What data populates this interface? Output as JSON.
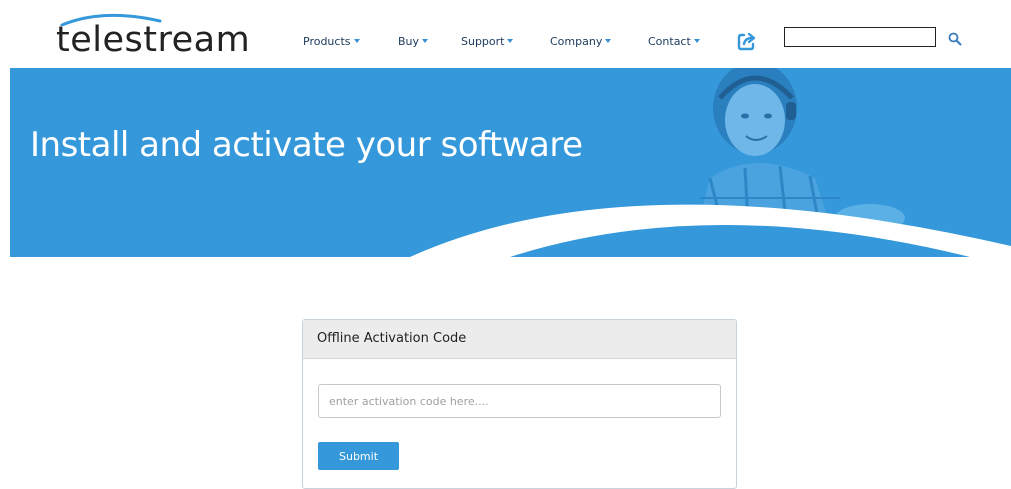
{
  "header": {
    "logo_text": "telestream",
    "nav": [
      {
        "label": "Products",
        "name": "nav-products"
      },
      {
        "label": "Buy",
        "name": "nav-buy"
      },
      {
        "label": "Support",
        "name": "nav-support"
      },
      {
        "label": "Company",
        "name": "nav-company"
      },
      {
        "label": "Contact",
        "name": "nav-contact"
      }
    ],
    "search": {
      "value": "",
      "placeholder": ""
    },
    "icons": {
      "share": "share-arrow-icon",
      "search": "search-icon"
    }
  },
  "hero": {
    "title": "Install and activate your software",
    "background_color": "#3498db"
  },
  "activation_panel": {
    "heading": "Offline Activation Code",
    "input_placeholder": "enter activation code here....",
    "input_value": "",
    "submit_label": "Submit"
  },
  "colors": {
    "accent": "#3498db",
    "nav_text": "#1b3a5c",
    "panel_header_bg": "#ececec"
  }
}
